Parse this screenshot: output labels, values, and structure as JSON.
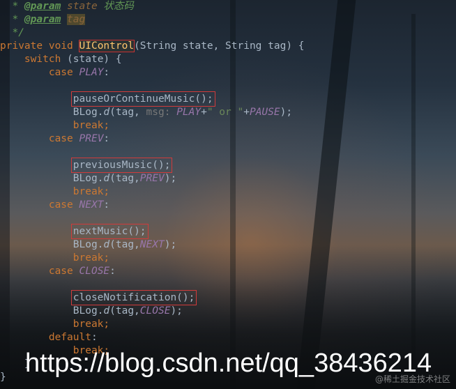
{
  "editor": {
    "lines": [
      {
        "segments": [
          [
            "  * ",
            "doc"
          ],
          [
            "@param",
            "doctag"
          ],
          [
            " ",
            "doc"
          ],
          [
            "state",
            "docparam"
          ],
          [
            " 状态码",
            "doc"
          ]
        ]
      },
      {
        "segments": [
          [
            "  * ",
            "doc"
          ],
          [
            "@param",
            "doctag"
          ],
          [
            " ",
            "doc"
          ],
          [
            "tag",
            "docparam hl"
          ]
        ]
      },
      {
        "segments": [
          [
            "  */",
            "doc"
          ]
        ]
      },
      {
        "segments": [
          [
            "private void ",
            "kw"
          ],
          [
            "UIControl",
            "fn-decl"
          ],
          [
            "(String state, String tag) {",
            ""
          ]
        ]
      },
      {
        "segments": [
          [
            "    ",
            ""
          ],
          [
            "switch",
            "kw"
          ],
          [
            " (state) {",
            ""
          ]
        ]
      },
      {
        "segments": [
          [
            "        ",
            ""
          ],
          [
            "case ",
            "kw"
          ],
          [
            "PLAY",
            "const"
          ],
          [
            ":",
            ""
          ]
        ]
      },
      {
        "segments": [
          [
            "",
            ""
          ]
        ]
      },
      {
        "segments": [
          [
            "            ",
            ""
          ],
          [
            "pauseOrContinueMusic();",
            "boxed"
          ]
        ]
      },
      {
        "segments": [
          [
            "            BLog.",
            ""
          ],
          [
            "d",
            "static-call"
          ],
          [
            "(tag, ",
            ""
          ],
          [
            "msg: ",
            "hint"
          ],
          [
            "PLAY",
            "const"
          ],
          [
            "+",
            ""
          ],
          [
            "\" or \"",
            "str"
          ],
          [
            "+",
            ""
          ],
          [
            "PAUSE",
            "const"
          ],
          [
            ");",
            ""
          ]
        ]
      },
      {
        "segments": [
          [
            "            ",
            ""
          ],
          [
            "break;",
            "kw"
          ]
        ]
      },
      {
        "segments": [
          [
            "        ",
            ""
          ],
          [
            "case ",
            "kw"
          ],
          [
            "PREV",
            "const"
          ],
          [
            ":",
            ""
          ]
        ]
      },
      {
        "segments": [
          [
            "",
            ""
          ]
        ]
      },
      {
        "segments": [
          [
            "            ",
            ""
          ],
          [
            "previousMusic();",
            "boxed"
          ]
        ]
      },
      {
        "segments": [
          [
            "            BLog.",
            ""
          ],
          [
            "d",
            "static-call"
          ],
          [
            "(tag,",
            ""
          ],
          [
            "PREV",
            "const"
          ],
          [
            ");",
            ""
          ]
        ]
      },
      {
        "segments": [
          [
            "            ",
            ""
          ],
          [
            "break;",
            "kw"
          ]
        ]
      },
      {
        "segments": [
          [
            "        ",
            ""
          ],
          [
            "case ",
            "kw"
          ],
          [
            "NEXT",
            "const"
          ],
          [
            ":",
            ""
          ]
        ]
      },
      {
        "segments": [
          [
            "",
            ""
          ]
        ]
      },
      {
        "segments": [
          [
            "            ",
            ""
          ],
          [
            "nextMusic();",
            "boxed"
          ]
        ]
      },
      {
        "segments": [
          [
            "            BLog.",
            ""
          ],
          [
            "d",
            "static-call"
          ],
          [
            "(tag,",
            ""
          ],
          [
            "NEXT",
            "const"
          ],
          [
            ");",
            ""
          ]
        ]
      },
      {
        "segments": [
          [
            "            ",
            ""
          ],
          [
            "break;",
            "kw"
          ]
        ]
      },
      {
        "segments": [
          [
            "        ",
            ""
          ],
          [
            "case ",
            "kw"
          ],
          [
            "CLOSE",
            "const"
          ],
          [
            ":",
            ""
          ]
        ]
      },
      {
        "segments": [
          [
            "",
            ""
          ]
        ]
      },
      {
        "segments": [
          [
            "            ",
            ""
          ],
          [
            "closeNotification();",
            "boxed"
          ]
        ]
      },
      {
        "segments": [
          [
            "            BLog.",
            ""
          ],
          [
            "d",
            "static-call"
          ],
          [
            "(tag,",
            ""
          ],
          [
            "CLOSE",
            "const"
          ],
          [
            ");",
            ""
          ]
        ]
      },
      {
        "segments": [
          [
            "            ",
            ""
          ],
          [
            "break;",
            "kw"
          ]
        ]
      },
      {
        "segments": [
          [
            "        ",
            ""
          ],
          [
            "default",
            "kw"
          ],
          [
            ":",
            ""
          ]
        ]
      },
      {
        "segments": [
          [
            "            ",
            ""
          ],
          [
            "break;",
            "kw"
          ]
        ]
      },
      {
        "segments": [
          [
            "    }",
            ""
          ]
        ]
      },
      {
        "segments": [
          [
            "}",
            ""
          ]
        ]
      }
    ]
  },
  "watermark": {
    "url": "https://blog.csdn.net/qq_38436214",
    "credit": "@稀土掘金技术社区"
  },
  "colors": {
    "keyword": "#cc7832",
    "doc_comment": "#629755",
    "constant": "#9876aa",
    "function_decl": "#ffc66d",
    "default_text": "#a9b7c6",
    "highlight_box": "#d13b3b"
  }
}
